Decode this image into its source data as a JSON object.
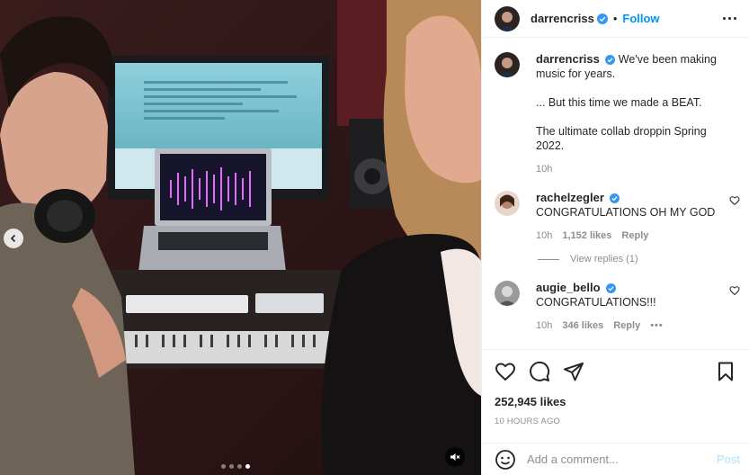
{
  "post": {
    "username": "darrencriss",
    "follow_label": "Follow",
    "bullet": "•",
    "caption_lines": [
      "We've been making music for years.",
      "... But this time we made a BEAT.",
      "The ultimate collab droppin Spring 2022."
    ],
    "caption_time": "10h",
    "likes": "252,945 likes",
    "posted_ago": "10 HOURS AGO"
  },
  "comments": [
    {
      "username": "rachelzegler",
      "text": "CONGRATULATIONS OH MY GOD",
      "time": "10h",
      "likes": "1,152 likes",
      "reply_label": "Reply",
      "view_replies": "View replies (1)"
    },
    {
      "username": "augie_bello",
      "text": "CONGRATULATIONS!!!",
      "time": "10h",
      "likes": "346 likes",
      "reply_label": "Reply",
      "more": "•••"
    }
  ],
  "add_comment": {
    "placeholder": "Add a comment...",
    "post_label": "Post"
  },
  "carousel": {
    "slides": 4,
    "active_index": 3
  },
  "icons": [
    "chevron-left-icon",
    "mute-icon",
    "more-icon",
    "verified-icon",
    "heart-icon",
    "comment-icon",
    "share-icon",
    "save-icon",
    "emoji-icon"
  ],
  "colors": {
    "accent": "#0095f6",
    "verified": "#3897f0",
    "post_disabled": "#b2dffc",
    "muted_text": "#8e8e8e"
  }
}
